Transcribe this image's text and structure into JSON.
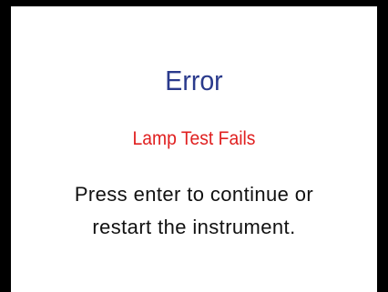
{
  "dialog": {
    "title": "Error",
    "subtitle": "Lamp Test Fails",
    "message_line1": "Press enter to continue or",
    "message_line2": "restart the instrument."
  },
  "colors": {
    "title": "#2a3a8c",
    "subtitle": "#e02020",
    "message": "#111111",
    "border": "#000000",
    "background": "#ffffff"
  }
}
